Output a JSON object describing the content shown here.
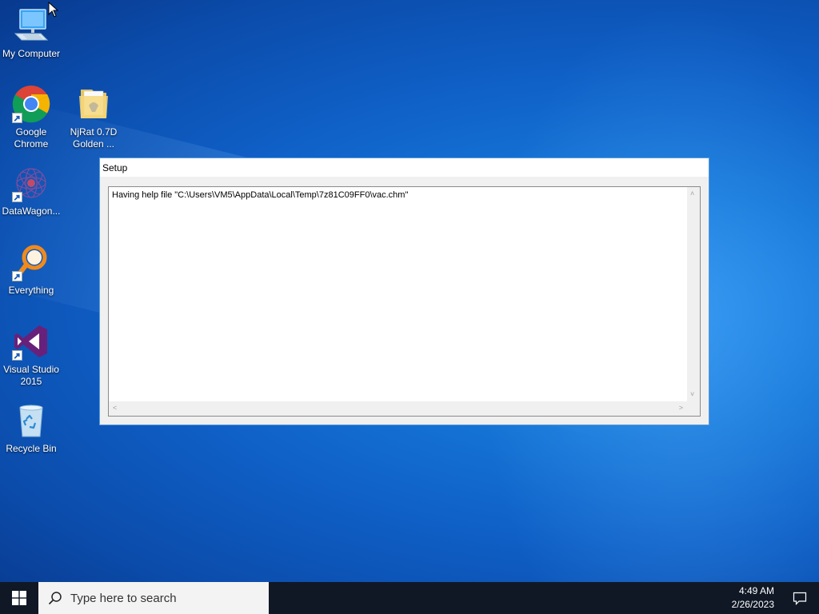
{
  "desktop": {
    "icons": [
      {
        "label": "My Computer",
        "icon": "monitor-icon"
      },
      {
        "label": "Google Chrome",
        "icon": "chrome-icon"
      },
      {
        "label": "NjRat 0.7D Golden ...",
        "icon": "folder-icon"
      },
      {
        "label": "DataWagon...",
        "icon": "datawagon-icon"
      },
      {
        "label": "Everything",
        "icon": "everything-icon"
      },
      {
        "label": "Visual Studio 2015",
        "icon": "visual-studio-icon"
      },
      {
        "label": "Recycle Bin",
        "icon": "recycle-bin-icon"
      }
    ]
  },
  "window": {
    "title": "Setup",
    "text": "Having help file \"C:\\Users\\VM5\\AppData\\Local\\Temp\\7z81C09FF0\\vac.chm\""
  },
  "taskbar": {
    "search_placeholder": "Type here to search",
    "time": "4:49 AM",
    "date": "2/26/2023"
  },
  "colors": {
    "desktop_accent": "#0f5fc6",
    "taskbar": "#101826",
    "window_border": "#5a9ad8"
  }
}
